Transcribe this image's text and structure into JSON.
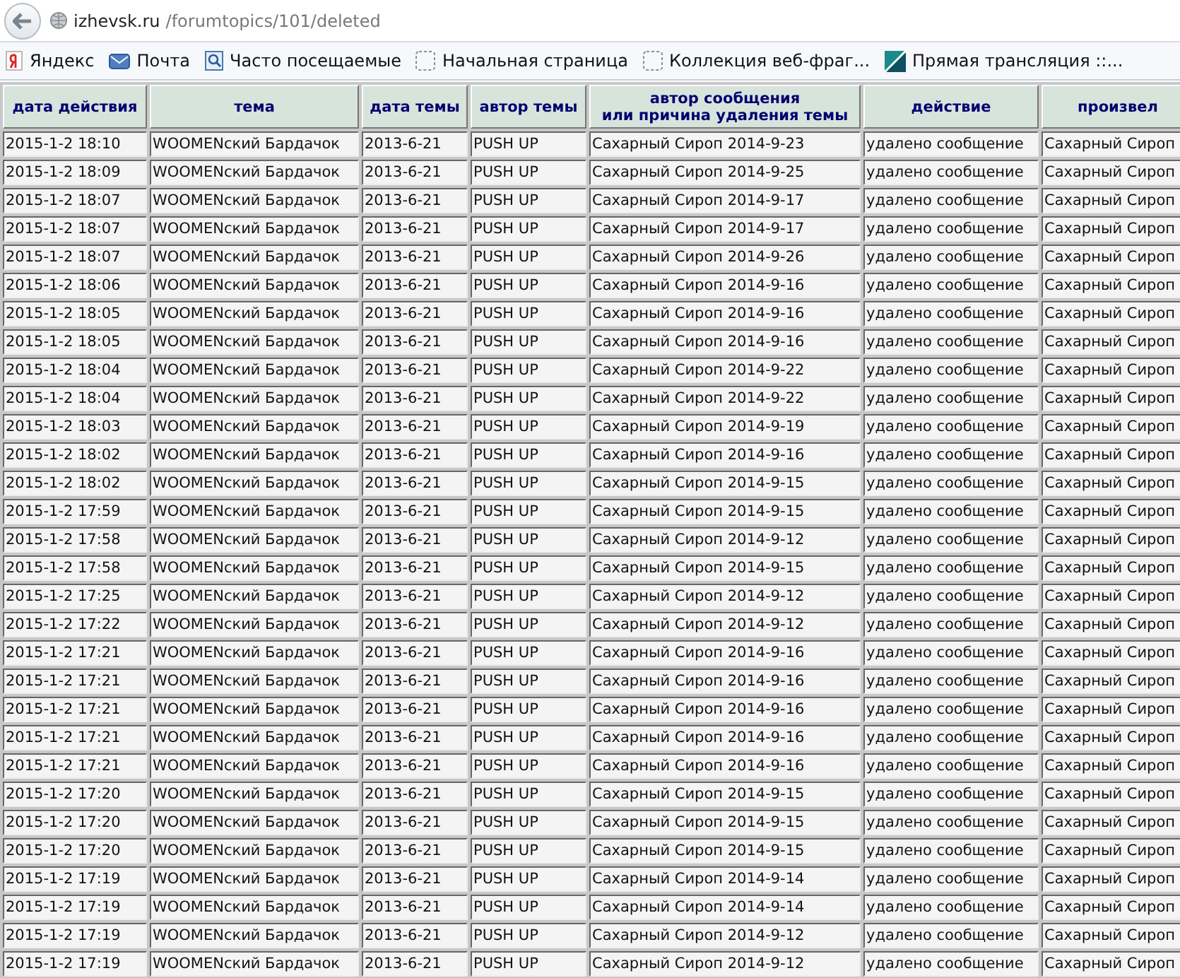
{
  "address_bar": {
    "domain": "izhevsk.ru",
    "path": "/forumtopics/101/deleted"
  },
  "bookmarks": [
    {
      "label": "Яндекс",
      "kind": "yandex"
    },
    {
      "label": "Почта",
      "kind": "mail"
    },
    {
      "label": "Часто посещаемые",
      "kind": "frequent"
    },
    {
      "label": "Начальная страница",
      "kind": "page"
    },
    {
      "label": "Коллекция веб-фраг...",
      "kind": "page"
    },
    {
      "label": "Прямая трансляция ::...",
      "kind": "live"
    }
  ],
  "table": {
    "columns": [
      "дата действия",
      "тема",
      "дата темы",
      "автор темы",
      "автор сообщения\nили причина удаления темы",
      "действие",
      "произвел"
    ],
    "rows": [
      [
        "2015-1-2 18:10",
        "WOOMENский Бардачок",
        "2013-6-21",
        "PUSH UP",
        "Сахарный Сироп 2014-9-23",
        "удалено сообщение",
        "Сахарный Сироп"
      ],
      [
        "2015-1-2 18:09",
        "WOOMENский Бардачок",
        "2013-6-21",
        "PUSH UP",
        "Сахарный Сироп 2014-9-25",
        "удалено сообщение",
        "Сахарный Сироп"
      ],
      [
        "2015-1-2 18:07",
        "WOOMENский Бардачок",
        "2013-6-21",
        "PUSH UP",
        "Сахарный Сироп 2014-9-17",
        "удалено сообщение",
        "Сахарный Сироп"
      ],
      [
        "2015-1-2 18:07",
        "WOOMENский Бардачок",
        "2013-6-21",
        "PUSH UP",
        "Сахарный Сироп 2014-9-17",
        "удалено сообщение",
        "Сахарный Сироп"
      ],
      [
        "2015-1-2 18:07",
        "WOOMENский Бардачок",
        "2013-6-21",
        "PUSH UP",
        "Сахарный Сироп 2014-9-26",
        "удалено сообщение",
        "Сахарный Сироп"
      ],
      [
        "2015-1-2 18:06",
        "WOOMENский Бардачок",
        "2013-6-21",
        "PUSH UP",
        "Сахарный Сироп 2014-9-16",
        "удалено сообщение",
        "Сахарный Сироп"
      ],
      [
        "2015-1-2 18:05",
        "WOOMENский Бардачок",
        "2013-6-21",
        "PUSH UP",
        "Сахарный Сироп 2014-9-16",
        "удалено сообщение",
        "Сахарный Сироп"
      ],
      [
        "2015-1-2 18:05",
        "WOOMENский Бардачок",
        "2013-6-21",
        "PUSH UP",
        "Сахарный Сироп 2014-9-16",
        "удалено сообщение",
        "Сахарный Сироп"
      ],
      [
        "2015-1-2 18:04",
        "WOOMENский Бардачок",
        "2013-6-21",
        "PUSH UP",
        "Сахарный Сироп 2014-9-22",
        "удалено сообщение",
        "Сахарный Сироп"
      ],
      [
        "2015-1-2 18:04",
        "WOOMENский Бардачок",
        "2013-6-21",
        "PUSH UP",
        "Сахарный Сироп 2014-9-22",
        "удалено сообщение",
        "Сахарный Сироп"
      ],
      [
        "2015-1-2 18:03",
        "WOOMENский Бардачок",
        "2013-6-21",
        "PUSH UP",
        "Сахарный Сироп 2014-9-19",
        "удалено сообщение",
        "Сахарный Сироп"
      ],
      [
        "2015-1-2 18:02",
        "WOOMENский Бардачок",
        "2013-6-21",
        "PUSH UP",
        "Сахарный Сироп 2014-9-16",
        "удалено сообщение",
        "Сахарный Сироп"
      ],
      [
        "2015-1-2 18:02",
        "WOOMENский Бардачок",
        "2013-6-21",
        "PUSH UP",
        "Сахарный Сироп 2014-9-15",
        "удалено сообщение",
        "Сахарный Сироп"
      ],
      [
        "2015-1-2 17:59",
        "WOOMENский Бардачок",
        "2013-6-21",
        "PUSH UP",
        "Сахарный Сироп 2014-9-15",
        "удалено сообщение",
        "Сахарный Сироп"
      ],
      [
        "2015-1-2 17:58",
        "WOOMENский Бардачок",
        "2013-6-21",
        "PUSH UP",
        "Сахарный Сироп 2014-9-12",
        "удалено сообщение",
        "Сахарный Сироп"
      ],
      [
        "2015-1-2 17:58",
        "WOOMENский Бардачок",
        "2013-6-21",
        "PUSH UP",
        "Сахарный Сироп 2014-9-15",
        "удалено сообщение",
        "Сахарный Сироп"
      ],
      [
        "2015-1-2 17:25",
        "WOOMENский Бардачок",
        "2013-6-21",
        "PUSH UP",
        "Сахарный Сироп 2014-9-12",
        "удалено сообщение",
        "Сахарный Сироп"
      ],
      [
        "2015-1-2 17:22",
        "WOOMENский Бардачок",
        "2013-6-21",
        "PUSH UP",
        "Сахарный Сироп 2014-9-12",
        "удалено сообщение",
        "Сахарный Сироп"
      ],
      [
        "2015-1-2 17:21",
        "WOOMENский Бардачок",
        "2013-6-21",
        "PUSH UP",
        "Сахарный Сироп 2014-9-16",
        "удалено сообщение",
        "Сахарный Сироп"
      ],
      [
        "2015-1-2 17:21",
        "WOOMENский Бардачок",
        "2013-6-21",
        "PUSH UP",
        "Сахарный Сироп 2014-9-16",
        "удалено сообщение",
        "Сахарный Сироп"
      ],
      [
        "2015-1-2 17:21",
        "WOOMENский Бардачок",
        "2013-6-21",
        "PUSH UP",
        "Сахарный Сироп 2014-9-16",
        "удалено сообщение",
        "Сахарный Сироп"
      ],
      [
        "2015-1-2 17:21",
        "WOOMENский Бардачок",
        "2013-6-21",
        "PUSH UP",
        "Сахарный Сироп 2014-9-16",
        "удалено сообщение",
        "Сахарный Сироп"
      ],
      [
        "2015-1-2 17:21",
        "WOOMENский Бардачок",
        "2013-6-21",
        "PUSH UP",
        "Сахарный Сироп 2014-9-16",
        "удалено сообщение",
        "Сахарный Сироп"
      ],
      [
        "2015-1-2 17:20",
        "WOOMENский Бардачок",
        "2013-6-21",
        "PUSH UP",
        "Сахарный Сироп 2014-9-15",
        "удалено сообщение",
        "Сахарный Сироп"
      ],
      [
        "2015-1-2 17:20",
        "WOOMENский Бардачок",
        "2013-6-21",
        "PUSH UP",
        "Сахарный Сироп 2014-9-15",
        "удалено сообщение",
        "Сахарный Сироп"
      ],
      [
        "2015-1-2 17:20",
        "WOOMENский Бардачок",
        "2013-6-21",
        "PUSH UP",
        "Сахарный Сироп 2014-9-15",
        "удалено сообщение",
        "Сахарный Сироп"
      ],
      [
        "2015-1-2 17:19",
        "WOOMENский Бардачок",
        "2013-6-21",
        "PUSH UP",
        "Сахарный Сироп 2014-9-14",
        "удалено сообщение",
        "Сахарный Сироп"
      ],
      [
        "2015-1-2 17:19",
        "WOOMENский Бардачок",
        "2013-6-21",
        "PUSH UP",
        "Сахарный Сироп 2014-9-14",
        "удалено сообщение",
        "Сахарный Сироп"
      ],
      [
        "2015-1-2 17:19",
        "WOOMENский Бардачок",
        "2013-6-21",
        "PUSH UP",
        "Сахарный Сироп 2014-9-12",
        "удалено сообщение",
        "Сахарный Сироп"
      ],
      [
        "2015-1-2 17:19",
        "WOOMENский Бардачок",
        "2013-6-21",
        "PUSH UP",
        "Сахарный Сироп 2014-9-12",
        "удалено сообщение",
        "Сахарный Сироп"
      ]
    ]
  }
}
